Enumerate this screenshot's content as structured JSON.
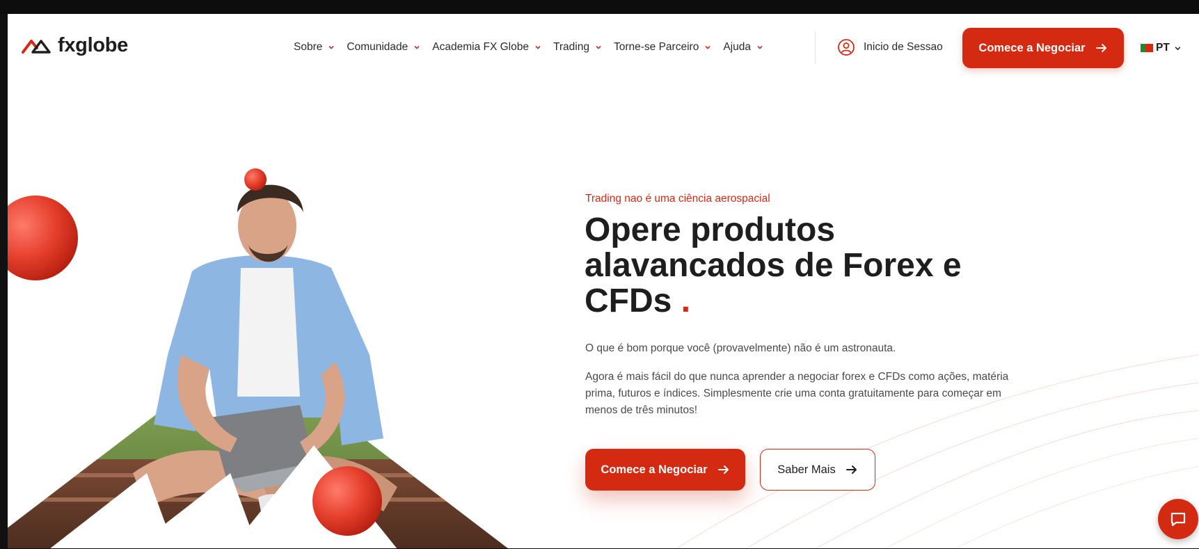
{
  "brand": {
    "name": "fxglobe",
    "accent": "#d42a12"
  },
  "nav": {
    "items": [
      {
        "label": "Sobre"
      },
      {
        "label": "Comunidade"
      },
      {
        "label": "Academia FX Globe"
      },
      {
        "label": "Trading"
      },
      {
        "label": "Torne-se Parceiro"
      },
      {
        "label": "Ajuda"
      }
    ],
    "login_label": "Inicio de Sessao",
    "cta_label": "Comece a Negociar",
    "language": "PT"
  },
  "hero": {
    "eyebrow": "Trading nao é uma ciência aerospacial",
    "headline_line1": "Opere produtos",
    "headline_line2": "alavancados de Forex e",
    "headline_line3": "CFDs",
    "headline_dot": ".",
    "subtitle": "O que é bom porque você (provavelmente) não é um astronauta.",
    "description": "Agora é mais fácil do que nunca aprender a negociar forex e CFDs como ações, matéria prima, futuros e índices. Simplesmente crie uma conta gratuitamente para começar em menos de três minutos!",
    "primary_cta": "Comece a Negociar",
    "secondary_cta": "Saber Mais"
  },
  "icons": {
    "nav_chevron": "chevron-down-icon",
    "login": "user-circle-icon",
    "arrow": "arrow-right-icon",
    "chat": "chat-bubble-icon",
    "flag": "portugal-flag-icon"
  }
}
